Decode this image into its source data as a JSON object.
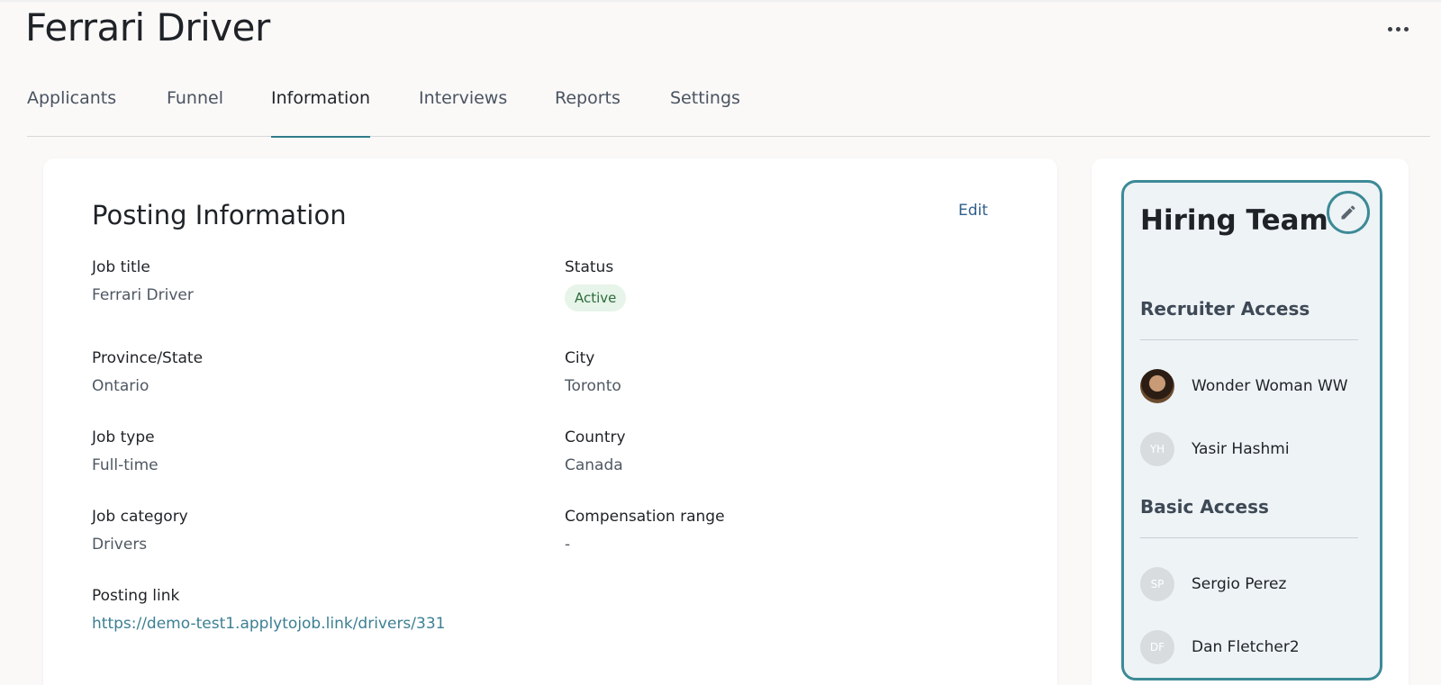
{
  "page": {
    "title": "Ferrari Driver",
    "more_icon": "more-horizontal-icon"
  },
  "tabs": [
    {
      "label": "Applicants",
      "active": false
    },
    {
      "label": "Funnel",
      "active": false
    },
    {
      "label": "Information",
      "active": true
    },
    {
      "label": "Interviews",
      "active": false
    },
    {
      "label": "Reports",
      "active": false
    },
    {
      "label": "Settings",
      "active": false
    }
  ],
  "posting": {
    "title": "Posting Information",
    "edit_label": "Edit",
    "fields": {
      "job_title": {
        "label": "Job title",
        "value": "Ferrari Driver"
      },
      "status": {
        "label": "Status",
        "value": "Active"
      },
      "province": {
        "label": "Province/State",
        "value": "Ontario"
      },
      "city": {
        "label": "City",
        "value": "Toronto"
      },
      "job_type": {
        "label": "Job type",
        "value": "Full-time"
      },
      "country": {
        "label": "Country",
        "value": "Canada"
      },
      "job_category": {
        "label": "Job category",
        "value": "Drivers"
      },
      "compensation": {
        "label": "Compensation range",
        "value": "-"
      },
      "posting_link": {
        "label": "Posting link",
        "value": "https://demo-test1.applytojob.link/drivers/331"
      }
    }
  },
  "hiring_team": {
    "title": "Hiring Team",
    "edit_icon": "pencil-icon",
    "recruiter_access": {
      "title": "Recruiter Access",
      "members": [
        {
          "name": "Wonder Woman WW",
          "initials": "",
          "avatar": "photo"
        },
        {
          "name": "Yasir Hashmi",
          "initials": "YH",
          "avatar": "initials"
        }
      ]
    },
    "basic_access": {
      "title": "Basic Access",
      "members": [
        {
          "name": "Sergio Perez",
          "initials": "SP",
          "avatar": "initials"
        },
        {
          "name": "Dan Fletcher2",
          "initials": "DF",
          "avatar": "initials"
        }
      ]
    }
  },
  "colors": {
    "accent": "#3c8a96",
    "link": "#3c7f93",
    "status_bg": "#e6f4e9",
    "status_text": "#2e6b3a"
  }
}
